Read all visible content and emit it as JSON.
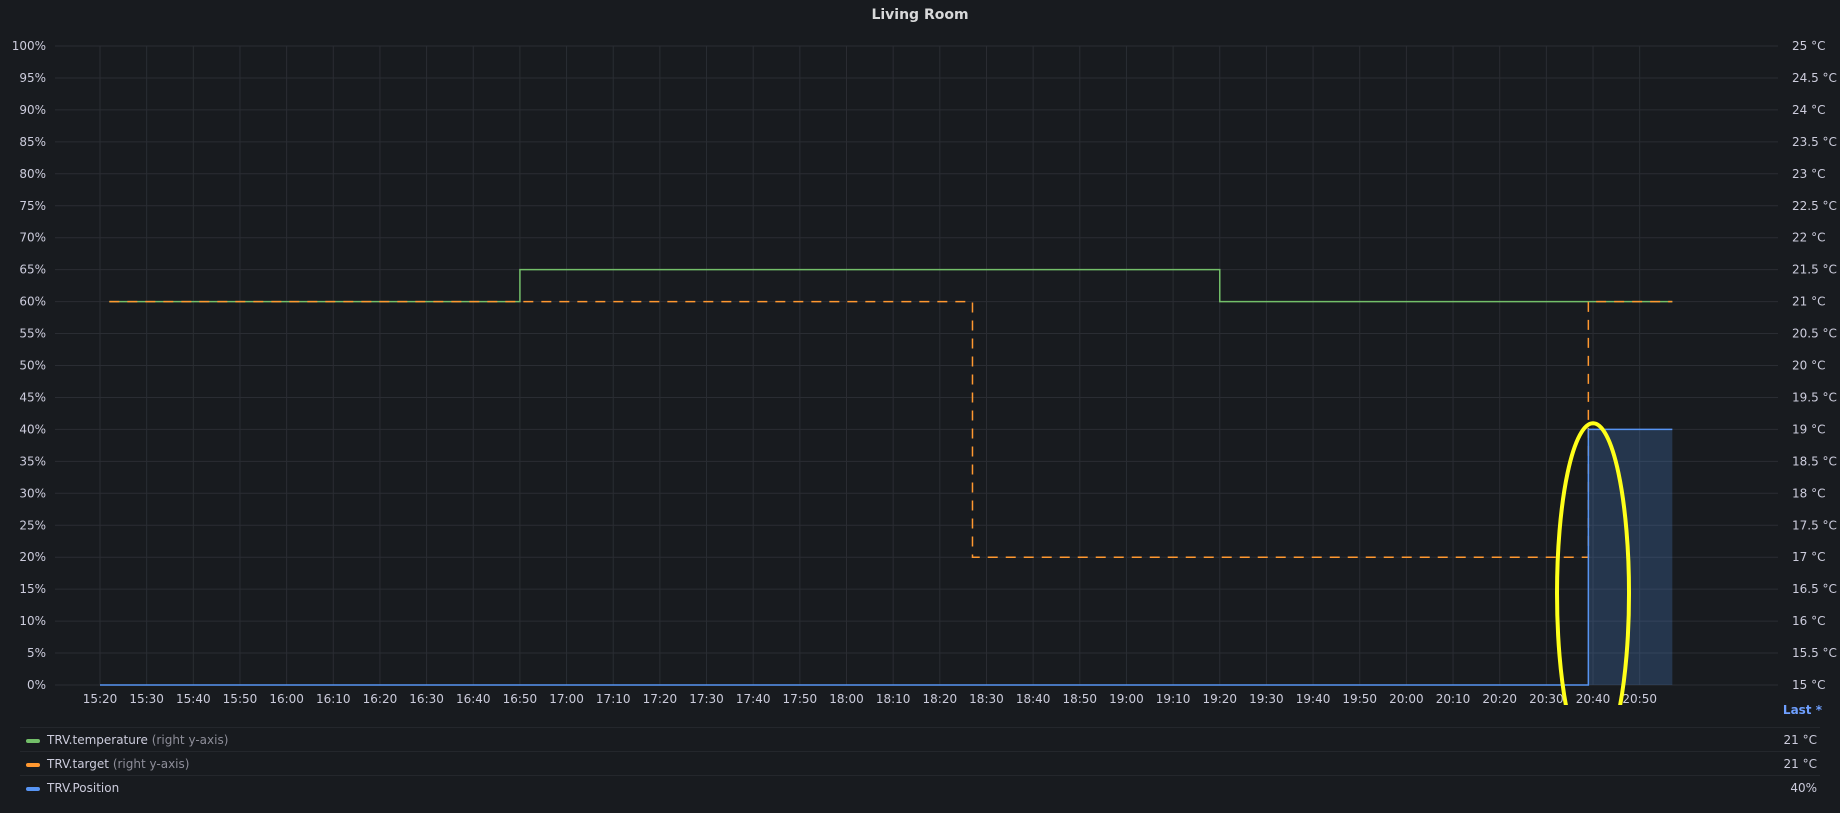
{
  "panel": {
    "title": "Living Room"
  },
  "legend": {
    "header": "Last *",
    "items": [
      {
        "name": "TRV.temperature",
        "axis_note": "(right y-axis)",
        "last": "21 °C",
        "color": "#73bf69"
      },
      {
        "name": "TRV.target",
        "axis_note": "(right y-axis)",
        "last": "21 °C",
        "color": "#ff9830"
      },
      {
        "name": "TRV.Position",
        "axis_note": "",
        "last": "40%",
        "color": "#5794f2"
      }
    ]
  },
  "chart_data": {
    "type": "line",
    "title": "Living Room",
    "x_tick_labels": [
      "15:20",
      "15:30",
      "15:40",
      "15:50",
      "16:00",
      "16:10",
      "16:20",
      "16:30",
      "16:40",
      "16:50",
      "17:00",
      "17:10",
      "17:20",
      "17:30",
      "17:40",
      "17:50",
      "18:00",
      "18:10",
      "18:20",
      "18:30",
      "18:40",
      "18:50",
      "19:00",
      "19:10",
      "19:20",
      "19:30",
      "19:40",
      "19:50",
      "20:00",
      "20:10",
      "20:20",
      "20:30",
      "20:40",
      "20:50"
    ],
    "x_range": [
      "15:20",
      "20:57"
    ],
    "y_left": {
      "unit": "%",
      "range": [
        0,
        100
      ],
      "tick_labels": [
        "0%",
        "5%",
        "10%",
        "15%",
        "20%",
        "25%",
        "30%",
        "35%",
        "40%",
        "45%",
        "50%",
        "55%",
        "60%",
        "65%",
        "70%",
        "75%",
        "80%",
        "85%",
        "90%",
        "95%",
        "100%"
      ]
    },
    "y_right": {
      "unit": "°C",
      "range": [
        15,
        25
      ],
      "tick_labels": [
        "15 °C",
        "15.5 °C",
        "16 °C",
        "16.5 °C",
        "17 °C",
        "17.5 °C",
        "18 °C",
        "18.5 °C",
        "19 °C",
        "19.5 °C",
        "20 °C",
        "20.5 °C",
        "21 °C",
        "21.5 °C",
        "22 °C",
        "22.5 °C",
        "23 °C",
        "23.5 °C",
        "24 °C",
        "24.5 °C",
        "25 °C"
      ]
    },
    "grid": true,
    "series": [
      {
        "name": "TRV.temperature",
        "axis": "right",
        "style": "solid",
        "color": "#73bf69",
        "points": [
          [
            "15:22",
            21
          ],
          [
            "16:50",
            21
          ],
          [
            "16:50",
            21.5
          ],
          [
            "19:20",
            21.5
          ],
          [
            "19:20",
            21
          ],
          [
            "20:57",
            21
          ]
        ]
      },
      {
        "name": "TRV.target",
        "axis": "right",
        "style": "dashed",
        "color": "#ff9830",
        "points": [
          [
            "15:22",
            21
          ],
          [
            "18:27",
            21
          ],
          [
            "18:27",
            17
          ],
          [
            "20:39",
            17
          ],
          [
            "20:39",
            21
          ],
          [
            "20:57",
            21
          ]
        ]
      },
      {
        "name": "TRV.Position",
        "axis": "left",
        "style": "solid-fill",
        "color": "#5794f2",
        "points": [
          [
            "15:20",
            0
          ],
          [
            "20:39",
            0
          ],
          [
            "20:39",
            40
          ],
          [
            "20:57",
            40
          ]
        ]
      }
    ],
    "annotation": {
      "shape": "ellipse",
      "color": "#ffff1a",
      "at_time": "20:40"
    }
  }
}
